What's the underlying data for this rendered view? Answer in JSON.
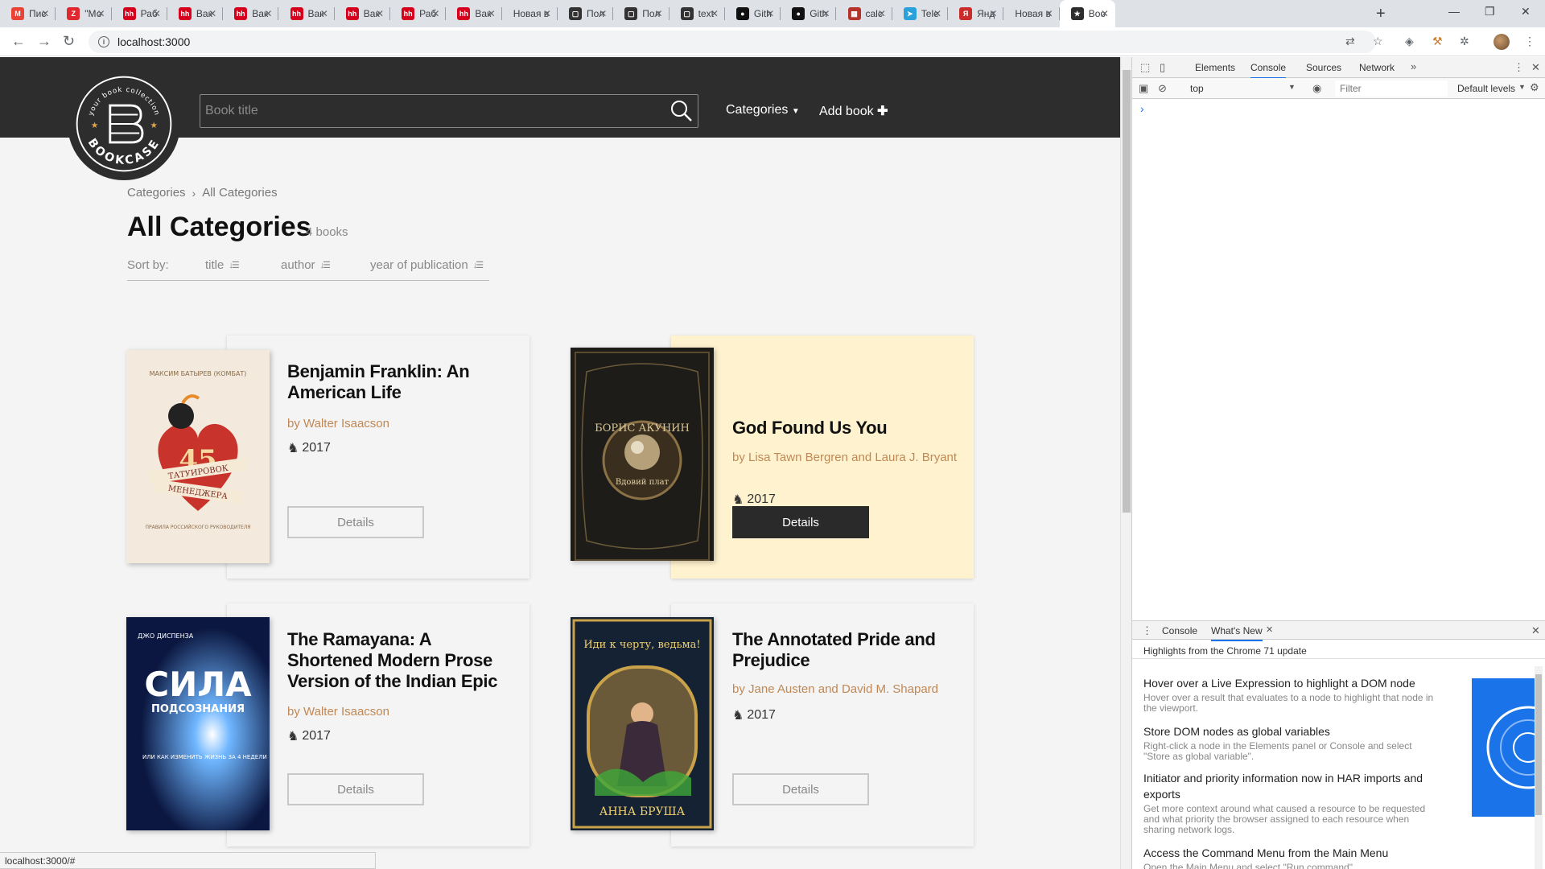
{
  "browser": {
    "tabs": [
      {
        "label": "Пис",
        "icon": "gmail-icon",
        "color": "#ea4335"
      },
      {
        "label": "\"Мо",
        "icon": "zeplin-icon",
        "color": "#e0282e"
      },
      {
        "label": "Раб",
        "icon": "hh-icon",
        "color": "#d6001c"
      },
      {
        "label": "Вак",
        "icon": "hh-icon",
        "color": "#d6001c"
      },
      {
        "label": "Вак",
        "icon": "hh-icon",
        "color": "#d6001c"
      },
      {
        "label": "Вак",
        "icon": "hh-icon",
        "color": "#d6001c"
      },
      {
        "label": "Вак",
        "icon": "hh-icon",
        "color": "#d6001c"
      },
      {
        "label": "Раб",
        "icon": "hh-icon",
        "color": "#d6001c"
      },
      {
        "label": "Вак",
        "icon": "hh-icon",
        "color": "#d6001c"
      },
      {
        "label": "Новая в",
        "icon": "none",
        "color": ""
      },
      {
        "label": "Пол",
        "icon": "chat-icon",
        "color": "#333333"
      },
      {
        "label": "Пол",
        "icon": "chat-icon",
        "color": "#333333"
      },
      {
        "label": "text",
        "icon": "chat-icon",
        "color": "#333333"
      },
      {
        "label": "Gith",
        "icon": "github-icon",
        "color": "#111111"
      },
      {
        "label": "Gith",
        "icon": "github-icon",
        "color": "#111111"
      },
      {
        "label": "calc",
        "icon": "calc-icon",
        "color": "#b5332a"
      },
      {
        "label": "Tele",
        "icon": "telegram-icon",
        "color": "#2aa1da"
      },
      {
        "label": "Янд",
        "icon": "yandex-icon",
        "color": "#cc2b2b"
      },
      {
        "label": "Новая в",
        "icon": "none",
        "color": ""
      },
      {
        "label": "Boo",
        "icon": "bookcase-icon",
        "color": "#2d2d2d"
      }
    ],
    "url": "localhost:3000"
  },
  "site": {
    "logo_text": "BOOKCASE",
    "logo_tagline": "your book collection",
    "search_placeholder": "Book title",
    "nav_categories": "Categories",
    "nav_add_book": "Add book",
    "breadcrumb": [
      "Categories",
      "All Categories"
    ],
    "page_title": "All Categories",
    "book_count": "4 books",
    "sort_label": "Sort by:",
    "sort_options": [
      "title",
      "author",
      "year of publication"
    ],
    "status_url": "localhost:3000/#"
  },
  "books": [
    {
      "title": "Benjamin Franklin: An American Life",
      "author": "by Walter Isaacson",
      "year": "2017",
      "button": "Details",
      "featured": false,
      "cover": {
        "top_text": "МАКСИМ БАТЫРЕВ (КОМБАТ)",
        "number": "45",
        "line1": "ТАТУИРОВОК",
        "line2": "МЕНЕДЖЕРА",
        "bottom_text": "ПРАВИЛА РОССИЙСКОГО РУКОВОДИТЕЛЯ"
      }
    },
    {
      "title": "God Found Us You",
      "author": "by Lisa Tawn Bergren and Laura J. Bryant",
      "year": "2017",
      "button": "Details",
      "featured": true,
      "cover": {
        "author": "БОРИС АКУНИН",
        "title": "Вдовий плат"
      }
    },
    {
      "title": "The Ramayana: A Shortened Modern Prose Version of the Indian Epic",
      "author": "by Walter Isaacson",
      "year": "2017",
      "button": "Details",
      "featured": false,
      "cover": {
        "top_text": "ДЖО ДИСПЕНЗА",
        "big": "СИЛА",
        "sub": "ПОДСОЗНАНИЯ",
        "bottom_text": "ИЛИ КАК ИЗМЕНИТЬ ЖИЗНЬ ЗА 4 НЕДЕЛИ"
      }
    },
    {
      "title": "The Annotated Pride and Prejudice",
      "author": "by Jane Austen and David M. Shapard",
      "year": "2017",
      "button": "Details",
      "featured": false,
      "cover": {
        "title": "Иди к черту, ведьма!",
        "author": "АННА БРУША"
      }
    }
  ],
  "devtools": {
    "tabs": [
      "Elements",
      "Console",
      "Sources",
      "Network"
    ],
    "context": "top",
    "filter_placeholder": "Filter",
    "levels": "Default levels",
    "prompt": "›",
    "drawer_tabs": [
      "Console",
      "What's New"
    ],
    "whats_new_header": "Highlights from the Chrome 71 update",
    "whats_new": [
      {
        "title": "Hover over a Live Expression to highlight a DOM node",
        "desc": "Hover over a result that evaluates to a node to highlight that node in the viewport."
      },
      {
        "title": "Store DOM nodes as global variables",
        "desc": "Right-click a node in the Elements panel or Console and select \"Store as global variable\"."
      },
      {
        "title": "Initiator and priority information now in HAR imports and exports",
        "desc": "Get more context around what caused a resource to be requested and what priority the browser assigned to each resource when sharing network logs."
      },
      {
        "title": "Access the Command Menu from the Main Menu",
        "desc": "Open the Main Menu and select \"Run command\"."
      }
    ]
  },
  "colors": {
    "header_bg": "#2d2d2d",
    "author_color": "#c08855",
    "featured_bg": "#fff3cf",
    "accent_blue": "#1a73e8"
  }
}
